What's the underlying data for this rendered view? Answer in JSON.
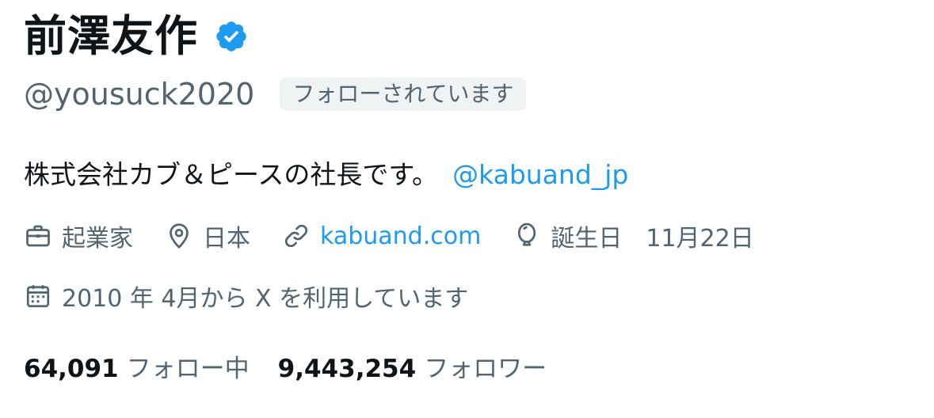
{
  "profile": {
    "display_name": "前澤友作",
    "verified": true,
    "handle": "@yousuck2020",
    "follows_you_badge": "フォローされています",
    "bio_text": "株式会社カブ＆ピースの社長です。",
    "bio_mention": "@kabuand_jp",
    "meta": {
      "category": {
        "icon": "briefcase-icon",
        "label": "起業家"
      },
      "location": {
        "icon": "location-pin-icon",
        "label": "日本"
      },
      "website": {
        "icon": "link-icon",
        "label": "kabuand.com"
      },
      "birthday": {
        "icon": "balloon-icon",
        "label": "誕生日",
        "value": "11月22日"
      },
      "joined": {
        "icon": "calendar-icon",
        "label": "2010 年 4月から X を利用しています"
      }
    },
    "stats": {
      "following_count": "64,091",
      "following_label": "フォロー中",
      "followers_count": "9,443,254",
      "followers_label": "フォロワー"
    }
  },
  "colors": {
    "text_primary": "#0f1419",
    "text_secondary": "#536471",
    "link": "#1d9bf0",
    "badge_bg": "#eff3f4",
    "verified": "#1d9bf0"
  }
}
